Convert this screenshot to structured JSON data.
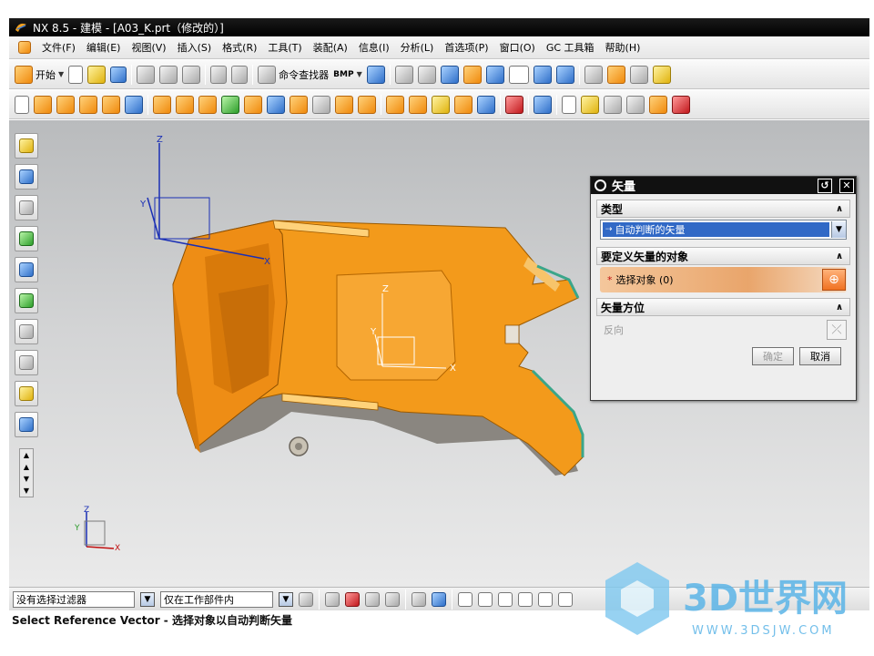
{
  "window": {
    "title": "NX 8.5 - 建模 - [A03_K.prt（修改的）]"
  },
  "menu": [
    "文件(F)",
    "编辑(E)",
    "视图(V)",
    "插入(S)",
    "格式(R)",
    "工具(T)",
    "装配(A)",
    "信息(I)",
    "分析(L)",
    "首选项(P)",
    "窗口(O)",
    "GC 工具箱",
    "帮助(H)"
  ],
  "toolbar": {
    "start_label": "开始",
    "command_finder_label": "命令查找器",
    "bmp_label": "BMP"
  },
  "viewport": {
    "wcs_axes": [
      "Z",
      "Y",
      "X"
    ],
    "part_axes": [
      "Z",
      "Y",
      "X"
    ],
    "triad_axes": [
      "Z",
      "Y",
      "X"
    ]
  },
  "dialog": {
    "title": "矢量",
    "type_group": "类型",
    "type_value": "自动判断的矢量",
    "object_group": "要定义矢量的对象",
    "object_label": "选择对象 (0)",
    "orientation_group": "矢量方位",
    "reverse_label": "反向",
    "ok_label": "确定",
    "cancel_label": "取消"
  },
  "statusbar": {
    "filter_value": "没有选择过滤器",
    "scope_value": "仅在工作部件内"
  },
  "prompt": "Select Reference Vector - 选择对象以自动判断矢量",
  "watermark": {
    "brand": "3D世界网",
    "url": "WWW.3DSJW.COM"
  },
  "colors": {
    "part": "#f39a1b",
    "accent": "#3169c6",
    "title": "#000000"
  }
}
